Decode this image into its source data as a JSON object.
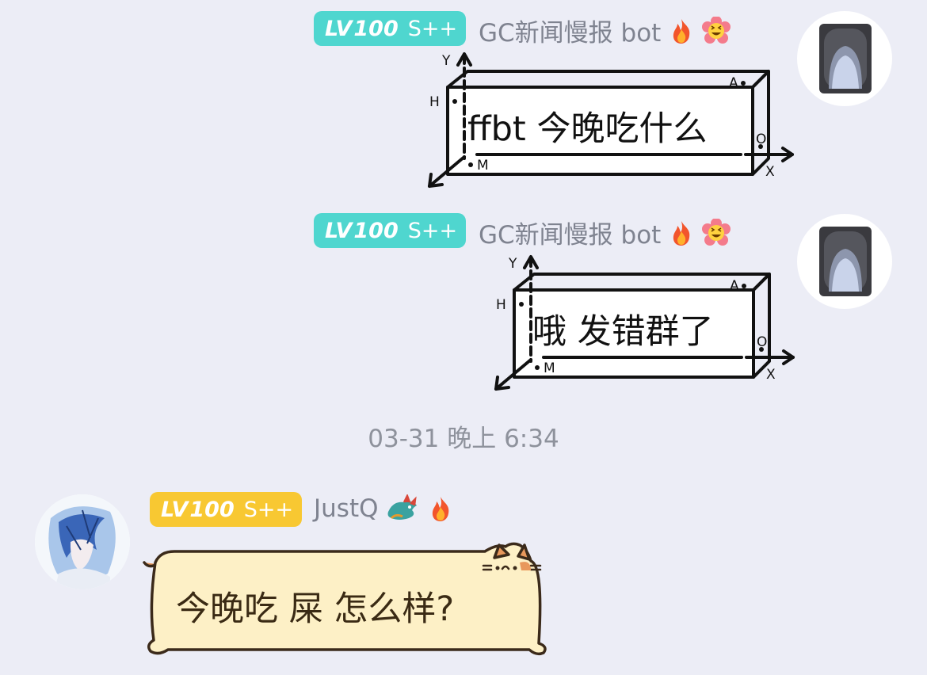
{
  "messages": [
    {
      "badge_level": "LV",
      "badge_number": "100",
      "badge_rank": "S++",
      "sender": "GC新闻慢报 bot",
      "icons": [
        "fire-icon",
        "laughing-flower-icon"
      ],
      "text": "ffbt 今晚吃什么",
      "box_labels": {
        "y": "Y",
        "h": "H",
        "a": "A",
        "o": "O",
        "m": "M",
        "x": "X"
      }
    },
    {
      "badge_level": "LV",
      "badge_number": "100",
      "badge_rank": "S++",
      "sender": "GC新闻慢报 bot",
      "icons": [
        "fire-icon",
        "laughing-flower-icon"
      ],
      "text": "哦 发错群了",
      "box_labels": {
        "y": "Y",
        "h": "H",
        "a": "A",
        "o": "O",
        "m": "M",
        "x": "X"
      }
    }
  ],
  "timestamp": "03-31 晚上 6:34",
  "reply": {
    "badge_level": "LV",
    "badge_number": "100",
    "badge_rank": "S++",
    "sender": "JustQ",
    "icons": [
      "dragon-icon",
      "fire-icon"
    ],
    "text": "今晚吃 屎 怎么样?"
  },
  "colors": {
    "background": "#ecedf6",
    "badge_teal": "#4fd6cf",
    "badge_gold": "#f8c832",
    "cat_bubble": "#fdf0c6",
    "cat_outline": "#3b2a1a"
  }
}
